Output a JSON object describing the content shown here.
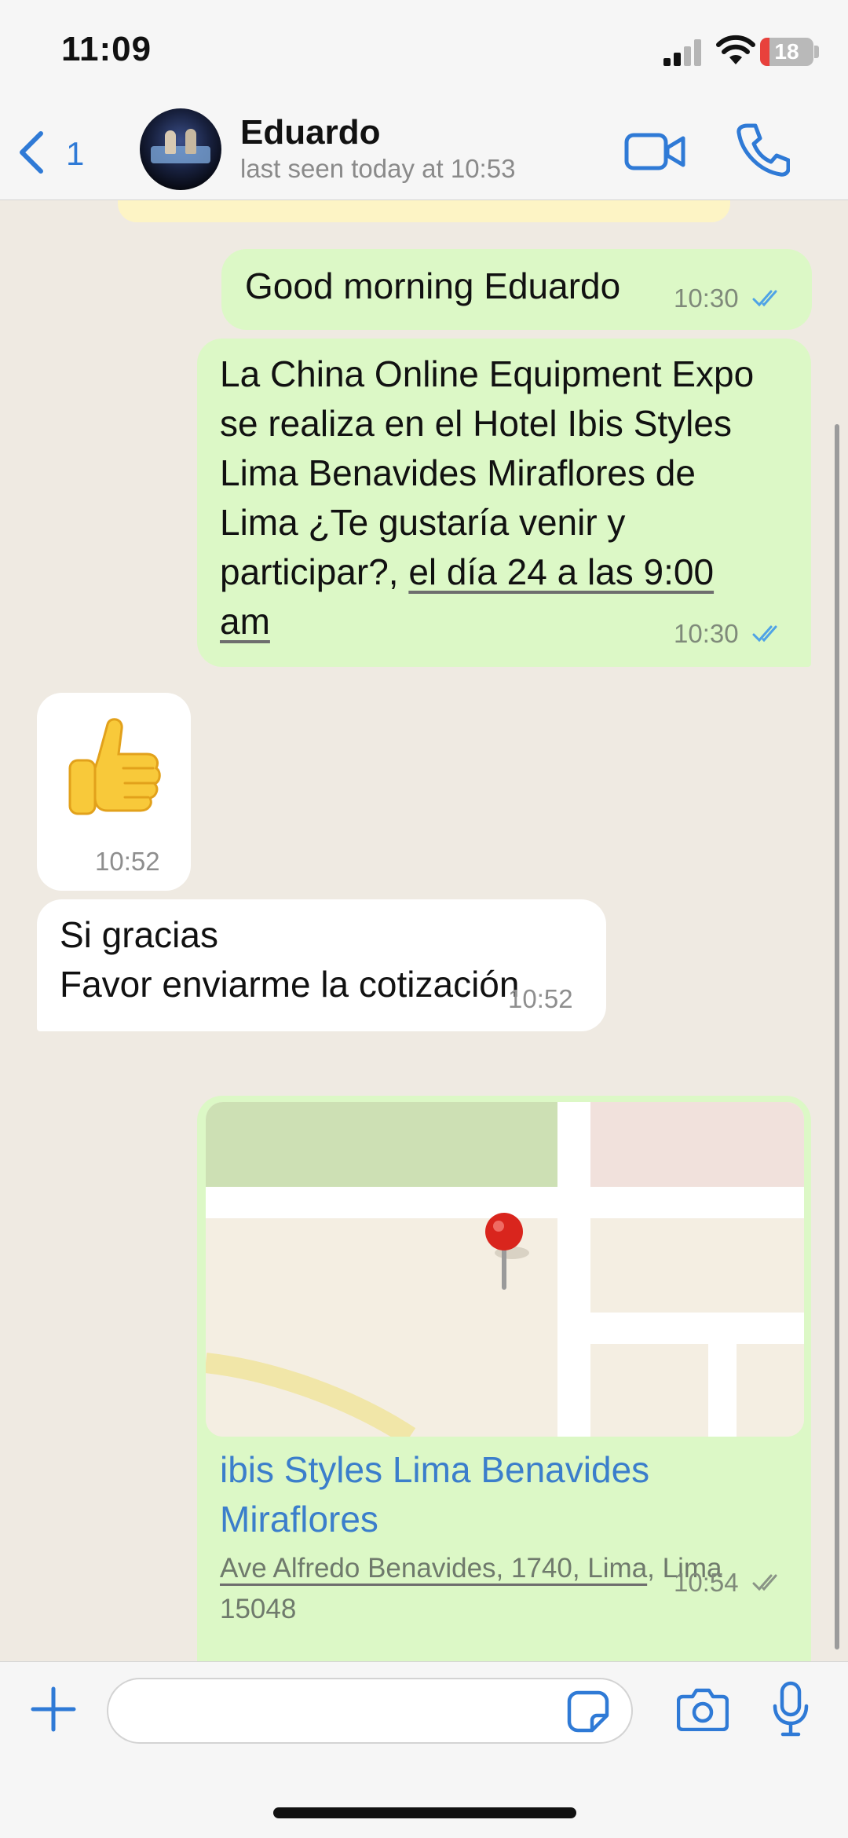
{
  "status_bar": {
    "time": "11:09",
    "battery": "18"
  },
  "header": {
    "back_count": "1",
    "contact_name": "Eduardo",
    "last_seen": "last seen today at 10:53"
  },
  "messages": [
    {
      "direction": "outgoing",
      "text": "Good morning Eduardo",
      "time": "10:30",
      "status": "read"
    },
    {
      "direction": "outgoing",
      "lines": [
        "La China Online Equipment Expo",
        "se realiza en el Hotel Ibis Styles",
        "Lima Benavides Miraflores de",
        "Lima ¿Te gustaría venir y"
      ],
      "line5_prefix": "participar?, ",
      "line5_link": "el día 24 a las 9:00",
      "line6_link": "am",
      "time": "10:30",
      "status": "read"
    },
    {
      "direction": "incoming",
      "emoji": "👍",
      "time": "10:52"
    },
    {
      "direction": "incoming",
      "line1": "Si gracias",
      "line2": "Favor enviarme la cotización",
      "time": "10:52"
    },
    {
      "direction": "outgoing",
      "type": "location",
      "place_line1": "ibis Styles Lima Benavides",
      "place_line2": "Miraflores",
      "address_part1": "Ave Alfredo Benavides, 1740, Lima",
      "address_part2": ", Lima",
      "address_line2": "15048",
      "time": "10:54",
      "status": "delivered"
    }
  ],
  "colors": {
    "accent": "#2f7ad6",
    "outgoing_bubble": "#dcf8c6",
    "incoming_bubble": "#ffffff",
    "read_ticks": "#4fa3e6",
    "chat_background": "#efeae2"
  },
  "icons": {
    "back": "chevron-left-icon",
    "video": "video-camera-icon",
    "call": "phone-icon",
    "attach": "plus-icon",
    "sticker": "sticker-icon",
    "camera": "camera-icon",
    "mic": "microphone-icon"
  }
}
